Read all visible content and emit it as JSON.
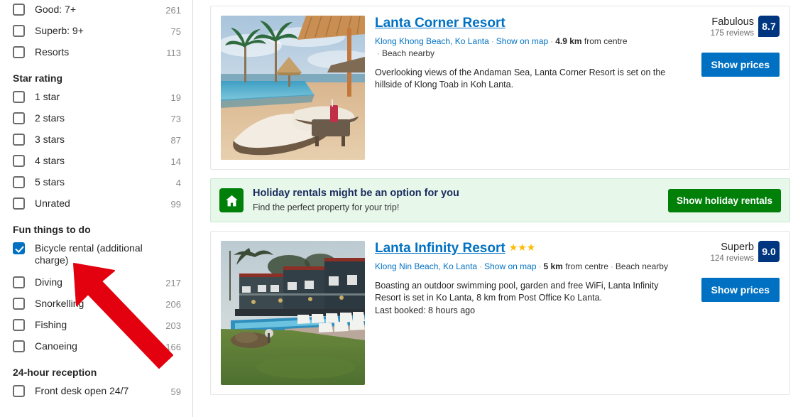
{
  "sidebar": {
    "top_filters": [
      {
        "label": "Good: 7+",
        "count": "261",
        "checked": false
      },
      {
        "label": "Superb: 9+",
        "count": "75",
        "checked": false
      },
      {
        "label": "Resorts",
        "count": "113",
        "checked": false
      }
    ],
    "groups": [
      {
        "title": "Star rating",
        "items": [
          {
            "label": "1 star",
            "count": "19",
            "checked": false
          },
          {
            "label": "2 stars",
            "count": "73",
            "checked": false
          },
          {
            "label": "3 stars",
            "count": "87",
            "checked": false
          },
          {
            "label": "4 stars",
            "count": "14",
            "checked": false
          },
          {
            "label": "5 stars",
            "count": "4",
            "checked": false
          },
          {
            "label": "Unrated",
            "count": "99",
            "checked": false
          }
        ]
      },
      {
        "title": "Fun things to do",
        "items": [
          {
            "label": "Bicycle rental (additional charge)",
            "count": "",
            "checked": true,
            "tall": true
          },
          {
            "label": "Diving",
            "count": "217",
            "checked": false
          },
          {
            "label": "Snorkelling",
            "count": "206",
            "checked": false
          },
          {
            "label": "Fishing",
            "count": "203",
            "checked": false
          },
          {
            "label": "Canoeing",
            "count": "166",
            "checked": false
          }
        ]
      },
      {
        "title": "24-hour reception",
        "items": [
          {
            "label": "Front desk open 24/7",
            "count": "59",
            "checked": false
          }
        ]
      }
    ]
  },
  "results": [
    {
      "name": "Lanta Corner Resort",
      "stars": "",
      "location": "Klong Khong Beach, Ko Lanta",
      "map_link": "Show on map",
      "distance": "4.9 km",
      "distance_suffix": "from centre",
      "nearby": "Beach nearby",
      "description": "Overlooking views of the Andaman Sea, Lanta Corner Resort is set on the hillside of Klong Toab in Koh Lanta.",
      "last_booked": "",
      "score_word": "Fabulous",
      "reviews": "175 reviews",
      "score": "8.7",
      "price_button": "Show prices",
      "image_alt": "pool-with-loungers-and-palm-trees"
    },
    {
      "name": "Lanta Infinity Resort",
      "stars": "★★★",
      "location": "Klong Nin Beach, Ko Lanta",
      "map_link": "Show on map",
      "distance": "5 km",
      "distance_suffix": "from centre",
      "nearby": "Beach nearby",
      "description": "Boasting an outdoor swimming pool, garden and free WiFi, Lanta Infinity Resort is set in Ko Lanta, 8 km from Post Office Ko Lanta.",
      "last_booked": "Last booked: 8 hours ago",
      "score_word": "Superb",
      "reviews": "124 reviews",
      "score": "9.0",
      "price_button": "Show prices",
      "image_alt": "resort-buildings-with-pool-at-dusk"
    }
  ],
  "banner": {
    "title": "Holiday rentals might be an option for you",
    "subtitle": "Find the perfect property for your trip!",
    "button": "Show holiday rentals",
    "icon": "house-icon"
  },
  "colors": {
    "link_blue": "#0071c2",
    "badge_navy": "#003580",
    "green": "#008009",
    "banner_bg": "#e7f7ea",
    "star_gold": "#febb02",
    "annotation_red": "#e3000f"
  },
  "annotation": {
    "type": "arrow",
    "points_to": "Bicycle rental (additional charge) checkbox",
    "color": "#e3000f"
  }
}
